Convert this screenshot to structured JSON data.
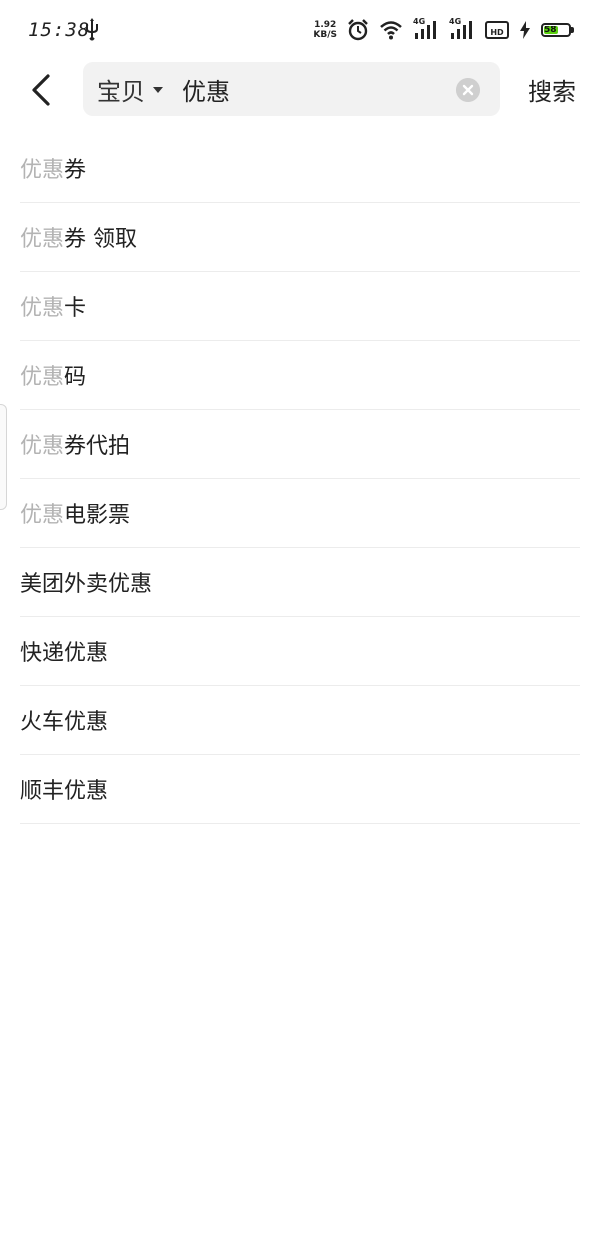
{
  "status_bar": {
    "time": "15:38",
    "net_speed_value": "1.92",
    "net_speed_unit": "KB/S",
    "network_1": "4G",
    "network_2": "4G",
    "hd_label": "HD",
    "battery_level": "58"
  },
  "search": {
    "scope": "宝贝",
    "query": "优惠",
    "submit_label": "搜索"
  },
  "suggestions": [
    {
      "highlight": "优惠",
      "rest": "券"
    },
    {
      "highlight": "优惠",
      "rest": "券 领取"
    },
    {
      "highlight": "优惠",
      "rest": "卡"
    },
    {
      "highlight": "优惠",
      "rest": "码"
    },
    {
      "highlight": "优惠",
      "rest": "券代拍"
    },
    {
      "highlight": "优惠",
      "rest": "电影票"
    },
    {
      "highlight": "",
      "rest": "美团外卖优惠"
    },
    {
      "highlight": "",
      "rest": "快递优惠"
    },
    {
      "highlight": "",
      "rest": "火车优惠"
    },
    {
      "highlight": "",
      "rest": "顺丰优惠"
    }
  ],
  "colors": {
    "highlight_text": "#b3b3b3",
    "search_box_bg": "#f2f2f2",
    "battery_fill": "#5ad10f"
  }
}
